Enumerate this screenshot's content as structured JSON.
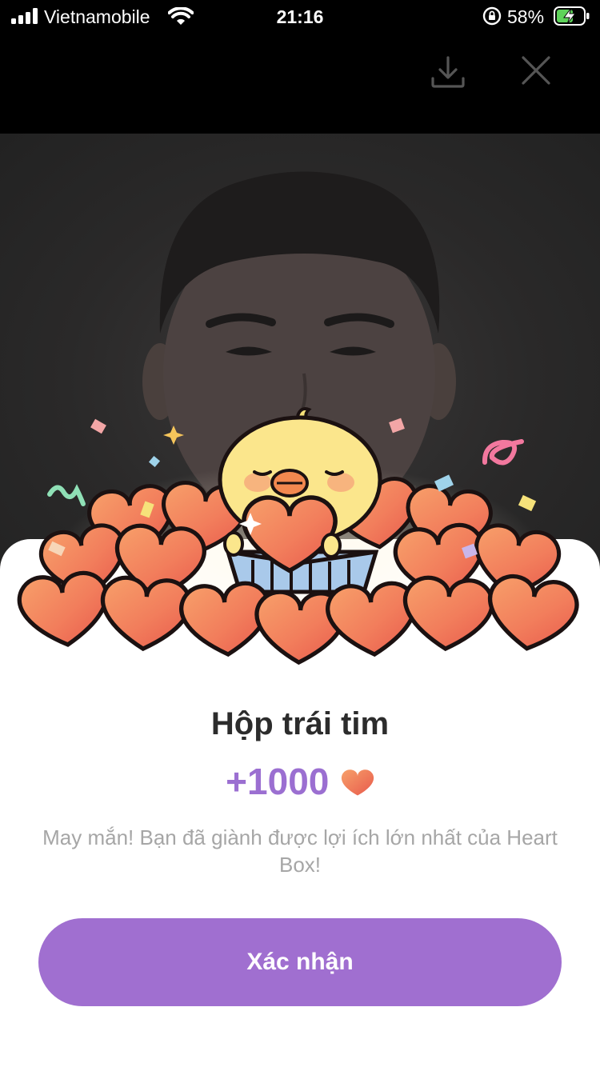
{
  "status_bar": {
    "carrier": "Vietnamobile",
    "time": "21:16",
    "battery_percent": "58%"
  },
  "top_bar": {
    "icons": [
      "download-icon",
      "close-icon"
    ]
  },
  "dialog": {
    "title": "Hộp trái tim",
    "reward_amount": "+1000",
    "reward_icon": "heart-icon",
    "message": "May mắn! Bạn đã giành được lợi ích lớn nhất của Heart Box!",
    "confirm_label": "Xác nhận"
  },
  "colors": {
    "accent": "#a06fd0",
    "reward_text": "#9b6fd1",
    "heart": "#ef6a55"
  }
}
